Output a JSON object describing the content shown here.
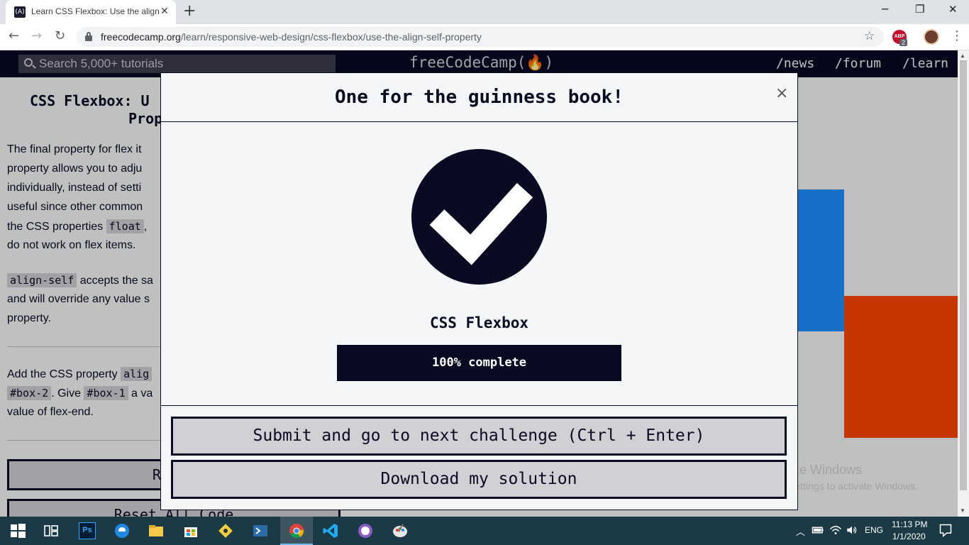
{
  "browser": {
    "tab_title": "Learn CSS Flexbox: Use the align-self Property | freeCodeCamp.org",
    "tab_favicon": "(A)",
    "new_tab": "+",
    "minimize": "─",
    "restore": "❐",
    "close": "✕",
    "back": "←",
    "forward": "→",
    "reload": "↻",
    "url_host": "freecodecamp.org",
    "url_path": "/learn/responsive-web-design/css-flexbox/use-the-align-self-property",
    "bookmark": "☆",
    "extension_label": "ABP",
    "extension_badge": "2",
    "menu": "⋮"
  },
  "fcc_nav": {
    "search_placeholder": "Search 5,000+ tutorials",
    "brand": "freeCodeCamp(🔥)",
    "links": [
      "/news",
      "/forum",
      "/learn"
    ]
  },
  "lesson": {
    "title_line1": "CSS Flexbox: U",
    "title_line2": "Prop",
    "para1": [
      "The final property for flex it",
      "property allows you to adju",
      "individually, instead of setti",
      "useful since other common ",
      "the CSS properties ",
      ", ",
      "do not work on flex items."
    ],
    "code_float": "float",
    "para2_code": "align-self",
    "para2": [
      " accepts the sa",
      "and will override any value s",
      "property."
    ],
    "para3_start": "Add the CSS property ",
    "para3_code1": "alig",
    "para3_code2": "#box-2",
    "para3_mid": ". Give ",
    "para3_code3": "#box-1",
    "para3_end": " a va",
    "para3_last": "value of flex-end.",
    "run_button": "Run t",
    "reset_button": "Reset All Code"
  },
  "modal": {
    "title": "One for the guinness book!",
    "close": "×",
    "block_name": "CSS Flexbox",
    "progress_percent": 100,
    "progress_label": "100% complete",
    "submit_button": "Submit and go to next challenge (Ctrl + Enter)",
    "download_button": "Download my solution"
  },
  "watermark": {
    "line1": "Activate Windows",
    "line2": "Go to Settings to activate Windows."
  },
  "taskbar": {
    "language": "ENG",
    "time": "11:13 PM",
    "date": "1/1/2020",
    "ps_label": "Ps"
  },
  "colors": {
    "fcc_dark": "#0a0a23",
    "preview_blue": "#1e90ff",
    "preview_red": "#ff4500"
  }
}
